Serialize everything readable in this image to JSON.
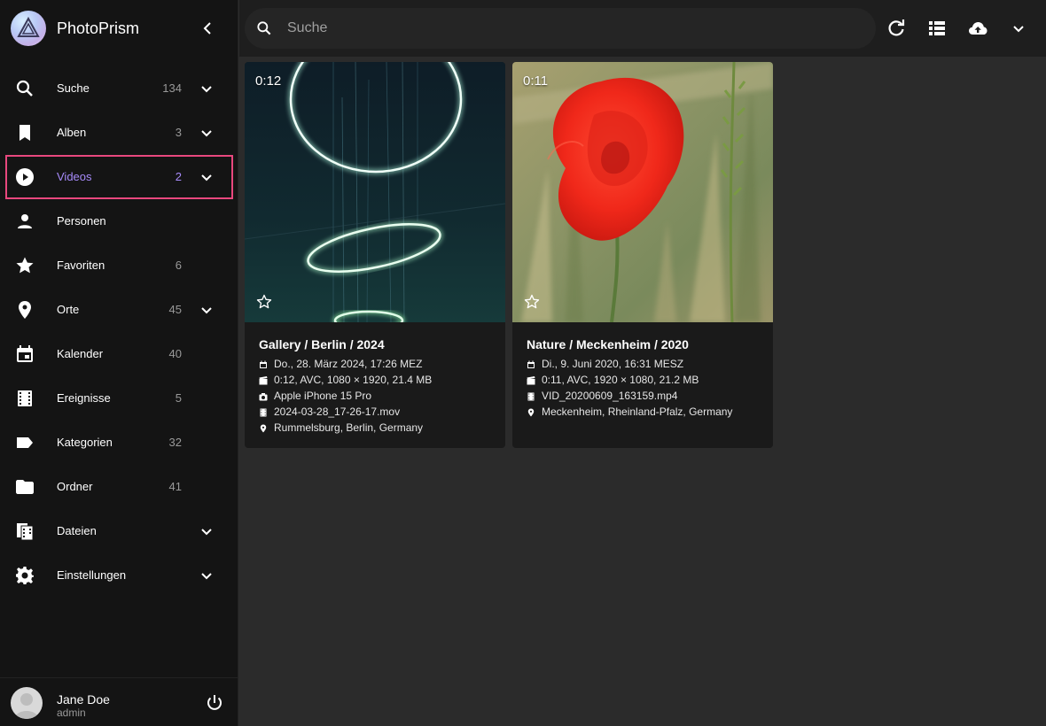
{
  "app": {
    "name": "PhotoPrism"
  },
  "sidebar": {
    "items": [
      {
        "label": "Suche",
        "count": "134",
        "icon": "search-icon",
        "expandable": true
      },
      {
        "label": "Alben",
        "count": "3",
        "icon": "bookmark-icon",
        "expandable": true
      },
      {
        "label": "Videos",
        "count": "2",
        "icon": "play-circle-icon",
        "expandable": true,
        "active": true
      },
      {
        "label": "Personen",
        "count": "",
        "icon": "person-icon",
        "expandable": false
      },
      {
        "label": "Favoriten",
        "count": "6",
        "icon": "star-icon",
        "expandable": false
      },
      {
        "label": "Orte",
        "count": "45",
        "icon": "map-pin-icon",
        "expandable": true
      },
      {
        "label": "Kalender",
        "count": "40",
        "icon": "calendar-icon",
        "expandable": false
      },
      {
        "label": "Ereignisse",
        "count": "5",
        "icon": "film-icon",
        "expandable": false
      },
      {
        "label": "Kategorien",
        "count": "32",
        "icon": "label-icon",
        "expandable": false
      },
      {
        "label": "Ordner",
        "count": "41",
        "icon": "folder-icon",
        "expandable": false
      },
      {
        "label": "Dateien",
        "count": "",
        "icon": "files-icon",
        "expandable": true
      },
      {
        "label": "Einstellungen",
        "count": "",
        "icon": "gear-icon",
        "expandable": true
      }
    ]
  },
  "user": {
    "name": "Jane Doe",
    "role": "admin"
  },
  "search": {
    "placeholder": "Suche"
  },
  "cards": [
    {
      "duration": "0:12",
      "title": "Gallery / Berlin / 2024",
      "meta": [
        {
          "icon": "calendar-icon",
          "text": "Do., 28. März 2024, 17:26 MEZ"
        },
        {
          "icon": "clapperboard-icon",
          "text": "0:12, AVC, 1080 × 1920, 21.4 MB"
        },
        {
          "icon": "camera-icon",
          "text": "Apple iPhone 15 Pro"
        },
        {
          "icon": "film-icon",
          "text": "2024-03-28_17-26-17.mov"
        },
        {
          "icon": "map-pin-icon",
          "text": "Rummelsburg, Berlin, Germany"
        }
      ]
    },
    {
      "duration": "0:11",
      "title": "Nature / Meckenheim / 2020",
      "meta": [
        {
          "icon": "calendar-icon",
          "text": "Di., 9. Juni 2020, 16:31 MESZ"
        },
        {
          "icon": "clapperboard-icon",
          "text": "0:11, AVC, 1920 × 1080, 21.2 MB"
        },
        {
          "icon": "film-icon",
          "text": "VID_20200609_163159.mp4"
        },
        {
          "icon": "map-pin-icon",
          "text": "Meckenheim, Rheinland-Pfalz, Germany"
        }
      ]
    }
  ],
  "colors": {
    "accent": "#a78bfa",
    "highlight": "#e8487e",
    "sidebar_bg": "#141414",
    "content_bg": "#2b2b2b"
  }
}
